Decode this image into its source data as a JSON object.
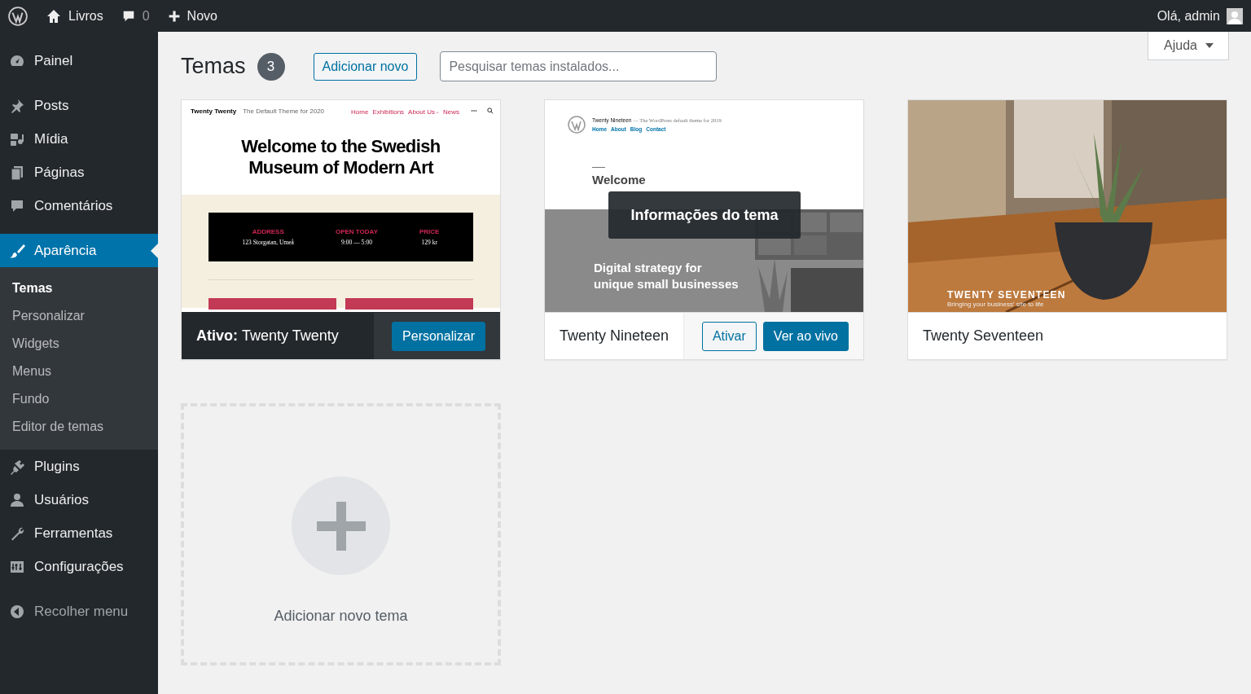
{
  "admin_bar": {
    "site": "Livros",
    "comments": "0",
    "new": "Novo",
    "greeting": "Olá, admin"
  },
  "sidebar": {
    "groups": [
      [
        {
          "label": "Painel",
          "selected": false
        }
      ],
      [
        {
          "label": "Posts",
          "selected": false
        },
        {
          "label": "Mídia",
          "selected": false
        },
        {
          "label": "Páginas",
          "selected": false
        },
        {
          "label": "Comentários",
          "selected": false
        }
      ],
      [
        {
          "label": "Aparência",
          "selected": true,
          "children": [
            {
              "label": "Temas",
              "selected": true
            },
            {
              "label": "Personalizar",
              "selected": false
            },
            {
              "label": "Widgets",
              "selected": false
            },
            {
              "label": "Menus",
              "selected": false
            },
            {
              "label": "Fundo",
              "selected": false
            },
            {
              "label": "Editor de temas",
              "selected": false
            }
          ]
        },
        {
          "label": "Plugins",
          "selected": false
        },
        {
          "label": "Usuários",
          "selected": false
        },
        {
          "label": "Ferramentas",
          "selected": false
        },
        {
          "label": "Configurações",
          "selected": false
        }
      ]
    ],
    "collapse": "Recolher menu"
  },
  "help_button": "Ajuda",
  "page": {
    "title": "Temas",
    "count": "3",
    "add_button": "Adicionar novo",
    "search": {
      "placeholder": "Pesquisar temas instalados..."
    }
  },
  "themes": [
    {
      "name": "Twenty Twenty",
      "active": true,
      "active_label": "Ativo:",
      "actions": [
        {
          "label": "Personalizar",
          "kind": "primary"
        }
      ],
      "preview": {
        "kind": "twentytwenty",
        "site_title": "Twenty Twenty",
        "tagline": "The Default Theme for 2020",
        "nav": [
          "Home",
          "Exhibitions",
          "About Us",
          "News"
        ],
        "heading": "Welcome to the Swedish Museum of Modern Art",
        "info": [
          {
            "label": "ADDRESS",
            "value": "123 Storgatan, Umeå"
          },
          {
            "label": "OPEN TODAY",
            "value": "9:00 — 5:00"
          },
          {
            "label": "PRICE",
            "value": "129 kr"
          }
        ]
      }
    },
    {
      "name": "Twenty Nineteen",
      "active": false,
      "details_label": "Informações do tema",
      "actions": [
        {
          "label": "Ativar",
          "kind": "secondary"
        },
        {
          "label": "Ver ao vivo",
          "kind": "primary"
        }
      ],
      "preview": {
        "kind": "twentynineteen",
        "site_title": "Twenty Nineteen",
        "tagline": "— The WordPress default theme for 2019",
        "nav": [
          "Home",
          "About",
          "Blog",
          "Contact"
        ],
        "heading": "Welcome",
        "hero": "Digital strategy for unique small businesses"
      }
    },
    {
      "name": "Twenty Seventeen",
      "active": false,
      "preview": {
        "kind": "twentyseventeen",
        "site_title": "TWENTY SEVENTEEN",
        "tagline": "Bringing your business' site to life"
      }
    }
  ],
  "add_theme": "Adicionar novo tema"
}
